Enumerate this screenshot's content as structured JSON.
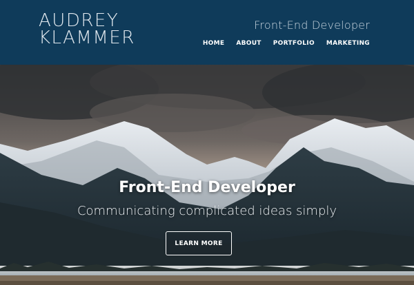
{
  "brand": {
    "line1": "AUDREY",
    "line2": "KLAMMER"
  },
  "header": {
    "tagline": "Front-End Developer"
  },
  "nav": [
    {
      "label": "HOME"
    },
    {
      "label": "ABOUT"
    },
    {
      "label": "PORTFOLIO"
    },
    {
      "label": "MARKETING"
    }
  ],
  "hero": {
    "title": "Front-End Developer",
    "subtitle": "Communicating complicated ideas simply",
    "cta": "LEARN MORE",
    "image": "mountain-landscape"
  },
  "colors": {
    "header_bg": "#0f3b5a",
    "text": "#ffffff"
  }
}
